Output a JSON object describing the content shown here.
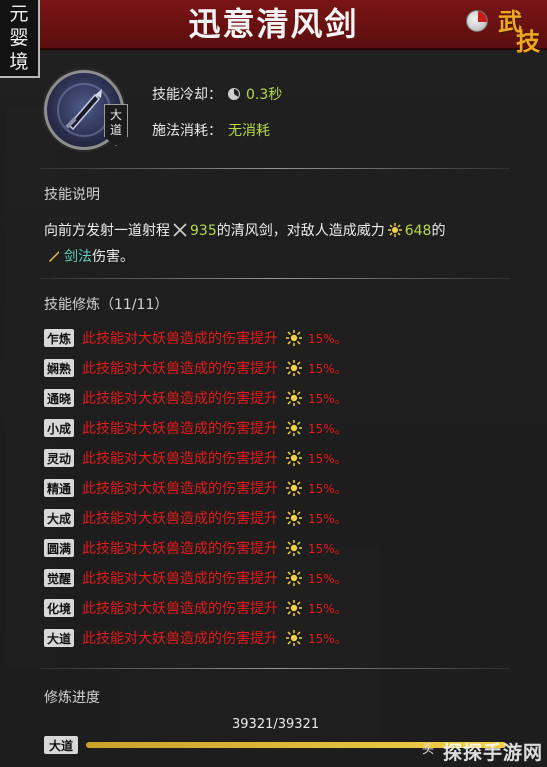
{
  "header": {
    "realm": [
      "元",
      "婴",
      "境"
    ],
    "skill_name": "迅意清风剑",
    "skill_type": [
      "武",
      "技"
    ]
  },
  "grade_badge": [
    "大",
    "道"
  ],
  "stats": {
    "cooldown_label": "技能冷却：",
    "cooldown_value": "0.3秒",
    "cost_label": "施法消耗：",
    "cost_value": "无消耗"
  },
  "description": {
    "section_title": "技能说明",
    "line1_pre": "向前方发射一道射程",
    "range": "935",
    "line1_mid": "的清风剑，对敌人造成威力",
    "power": "648",
    "line1_post": "的",
    "dmg_type": "剑法",
    "line2_post": "伤害。"
  },
  "cultivation": {
    "section_title": "技能修炼（11/11）",
    "rows": [
      {
        "tier": "乍炼",
        "text": "此技能对大妖兽造成的伤害提升",
        "value": "15%。"
      },
      {
        "tier": "娴熟",
        "text": "此技能对大妖兽造成的伤害提升",
        "value": "15%。"
      },
      {
        "tier": "通晓",
        "text": "此技能对大妖兽造成的伤害提升",
        "value": "15%。"
      },
      {
        "tier": "小成",
        "text": "此技能对大妖兽造成的伤害提升",
        "value": "15%。"
      },
      {
        "tier": "灵动",
        "text": "此技能对大妖兽造成的伤害提升",
        "value": "15%。"
      },
      {
        "tier": "精通",
        "text": "此技能对大妖兽造成的伤害提升",
        "value": "15%。"
      },
      {
        "tier": "大成",
        "text": "此技能对大妖兽造成的伤害提升",
        "value": "15%。"
      },
      {
        "tier": "圆满",
        "text": "此技能对大妖兽造成的伤害提升",
        "value": "15%。"
      },
      {
        "tier": "觉醒",
        "text": "此技能对大妖兽造成的伤害提升",
        "value": "15%。"
      },
      {
        "tier": "化境",
        "text": "此技能对大妖兽造成的伤害提升",
        "value": "15%。"
      },
      {
        "tier": "大道",
        "text": "此技能对大妖兽造成的伤害提升",
        "value": "15%。"
      }
    ]
  },
  "progress": {
    "section_title": "修炼进度",
    "value_text": "39321/39321",
    "tier": "大道",
    "fraction": 1.0,
    "end_label": "头"
  },
  "watermark": "探探手游网",
  "colors": {
    "header_red": "#7a1414",
    "value_green": "#b7d84a",
    "bonus_red": "#e21b1b",
    "accent_gold": "#f0a820",
    "teal": "#5fd0c0"
  }
}
